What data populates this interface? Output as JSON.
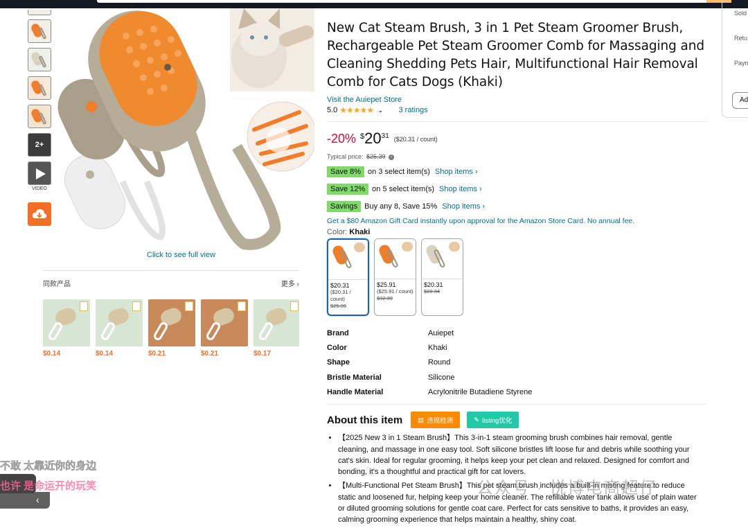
{
  "thumbnails": {
    "more_label": "2+",
    "video_label": "VIDEO"
  },
  "main_image": {
    "click_label": "Click to see full view"
  },
  "similar": {
    "title": "同款产品",
    "more": "更多",
    "items": [
      {
        "price": "$0.14",
        "bg": "#d7e6d3"
      },
      {
        "price": "$0.14",
        "bg": "#d7e6d3"
      },
      {
        "price": "$0.21",
        "bg": "#c98a5b"
      },
      {
        "price": "$0.21",
        "bg": "#c98a5b"
      },
      {
        "price": "$0.17",
        "bg": "#d7e6d3"
      }
    ]
  },
  "product": {
    "title": "New Cat Steam Brush, 3 in 1 Pet Steam Groomer Brush, Rechargeable Pet Steam Groomer Comb for Massaging and Cleaning Shedding Pets Hair, Multifunctional Hair Removal Comb for Cats Dogs (Khaki)",
    "store": "Visit the Auiepet Store",
    "rating_value": "5.0",
    "stars": "★★★★★",
    "ratings_count": "3 ratings",
    "discount": "-20%",
    "price_symbol": "$",
    "price_whole": "20",
    "price_fraction": "31",
    "unit_price": "($20.31 / count)",
    "typical_label": "Typical price:",
    "typical_price": "$25.39",
    "promos": [
      {
        "tag": "Save 8%",
        "text": "on 3 select item(s)",
        "link": "Shop items ›"
      },
      {
        "tag": "Save 12%",
        "text": "on 5 select item(s)",
        "link": "Shop items ›"
      },
      {
        "tag": "Savings",
        "text": "Buy any 8, Save 15%",
        "link": "Shop items ›"
      }
    ],
    "gift_card": "Get a $80 Amazon Gift Card instantly upon approval for the Amazon Store Card. No annual fee.",
    "color_label": "Color:",
    "color_value": "Khaki",
    "variants": [
      {
        "price": "$20.31",
        "unit": "($20.31 / count)",
        "old": "$25.39"
      },
      {
        "price": "$25.91",
        "unit": "($25.91 / count)",
        "old": "$32.39"
      },
      {
        "price": "$20.31",
        "unit": "",
        "old": "$22.34"
      }
    ],
    "specs": [
      {
        "key": "Brand",
        "value": "Auiepet"
      },
      {
        "key": "Color",
        "value": "Khaki"
      },
      {
        "key": "Shape",
        "value": "Round"
      },
      {
        "key": "Bristle Material",
        "value": "Silicone"
      },
      {
        "key": "Handle Material",
        "value": "Acrylonitrile Butadiene Styrene"
      }
    ],
    "about_title": "About this item",
    "ext_buttons": [
      "违规检测",
      "listing优化"
    ],
    "bullets": [
      "【2025 New 3 in 1 Steam Brush】This 3-in-1 steam grooming brush combines hair removal, gentle cleaning, and massage in one easy tool. Soft silicone bristles lift loose fur and debris while soothing your cat's skin. Ideal for regular grooming, it helps keep your pet clean and relaxed. Designed for comfort and bonding, it's a thoughtful and practical gift for cat lovers.",
      "【Multi-Functional Pet Steam Brush】This pet steam brush includes a built-in misting feature to reduce static and loosened fur, helping keep your home cleaner. The refillable water tank allows use of plain water or diluted grooming solutions for gentle coat care. Perfect for cats sensitive to baths, it provides an easy, calming grooming experience that helps maintain a healthy, shiny coat."
    ]
  },
  "buybox": {
    "line1": "Sold",
    "line2": "Retu",
    "line3": "Paym",
    "add_button": "Ad"
  },
  "overlays": {
    "subtitle1": "不敢 太靠近你的身边",
    "subtitle2": "也许 是命运开的玩笑",
    "watermark": "公众号 · 悦博电商超仔"
  },
  "colors": {
    "link": "#007185",
    "deal": "#cc0c39",
    "promo_green": "#7fda69",
    "accent_orange": "#f56e28"
  }
}
